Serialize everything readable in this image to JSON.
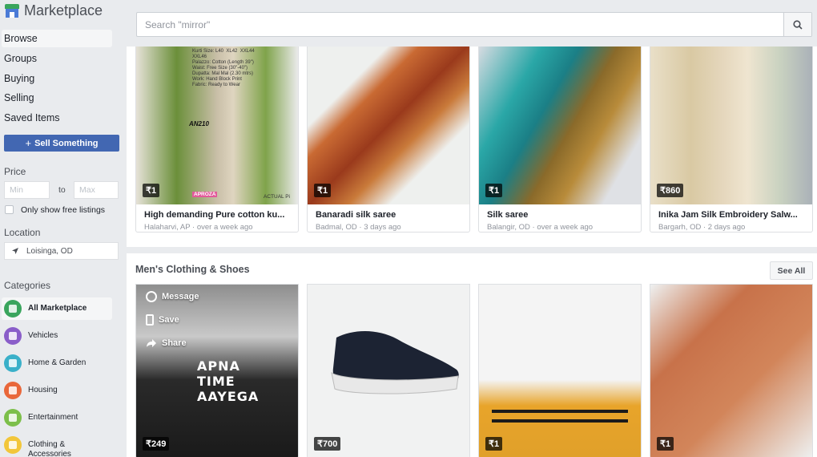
{
  "brand": {
    "title": "Marketplace",
    "icon": "store-icon"
  },
  "nav": [
    {
      "label": "Browse",
      "active": true
    },
    {
      "label": "Groups",
      "active": false
    },
    {
      "label": "Buying",
      "active": false
    },
    {
      "label": "Selling",
      "active": false
    },
    {
      "label": "Saved Items",
      "active": false
    }
  ],
  "sell_button": {
    "label": "Sell Something",
    "icon": "plus-icon"
  },
  "price": {
    "heading": "Price",
    "min_placeholder": "Min",
    "to_label": "to",
    "max_placeholder": "Max",
    "free_label": "Only show free listings",
    "free_checked": false
  },
  "location": {
    "heading": "Location",
    "value": "Loisinga, OD",
    "icon": "navigation-arrow-icon"
  },
  "categories": {
    "heading": "Categories",
    "items": [
      {
        "label": "All Marketplace",
        "active": true,
        "icon": "marketplace-icon",
        "color": "#3aa55d"
      },
      {
        "label": "Vehicles",
        "active": false,
        "icon": "vehicle-icon",
        "color": "#8a5ec9"
      },
      {
        "label": "Home & Garden",
        "active": false,
        "icon": "home-garden-icon",
        "color": "#3ab0c9"
      },
      {
        "label": "Housing",
        "active": false,
        "icon": "housing-icon",
        "color": "#e9673a"
      },
      {
        "label": "Entertainment",
        "active": false,
        "icon": "entertainment-icon",
        "color": "#7cbf4a"
      },
      {
        "label": "Clothing & Accessories",
        "active": false,
        "icon": "clothing-icon",
        "color": "#f2c63a"
      }
    ]
  },
  "search": {
    "placeholder": "Search \"mirror\"",
    "value": "",
    "icon": "search-icon"
  },
  "top_listings": [
    {
      "price": "₹1",
      "title": "High demanding Pure cotton ku...",
      "location": "Halaharvi, AP",
      "time": "over a week ago"
    },
    {
      "price": "₹1",
      "title": "Banaradi silk saree",
      "location": "Badmal, OD",
      "time": "3 days ago"
    },
    {
      "price": "₹1",
      "title": "Silk saree",
      "location": "Balangir, OD",
      "time": "over a week ago"
    },
    {
      "price": "₹860",
      "title": "Inika Jam Silk Embroidery Salw...",
      "location": "Bargarh, OD",
      "time": "2 days ago"
    }
  ],
  "image_texts": {
    "card1_lines": "Kurti Size: L40  XL42  XXL44\nXXL46\nPalazzo: Cotton (Length 39\")\nWaist: Free Size (30\"-40\")\nDupatta: Mal Mal (2.30 mtrs)\nWork: Hand Block Print\nFabric: Ready to Wear",
    "card1_code": "AN210",
    "card1_brand": "APROZA",
    "card1_tag": "ACTUAL Pi",
    "tee": "APNA TIME AAYEGA"
  },
  "mens_section": {
    "title": "Men's Clothing & Shoes",
    "see_all": "See All",
    "overlay_actions": [
      {
        "label": "Message",
        "icon": "messenger-icon"
      },
      {
        "label": "Save",
        "icon": "bookmark-icon"
      },
      {
        "label": "Share",
        "icon": "share-icon"
      }
    ],
    "listings": [
      {
        "price": "₹249"
      },
      {
        "price": "₹700"
      },
      {
        "price": "₹1"
      },
      {
        "price": "₹1"
      }
    ]
  }
}
